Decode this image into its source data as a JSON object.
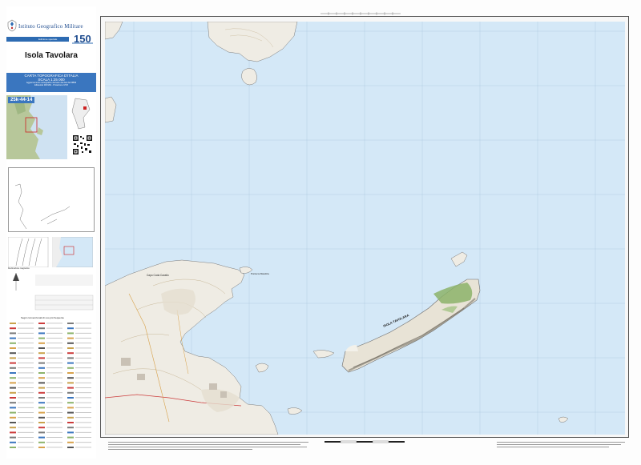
{
  "header": {
    "org_name": "Istituto Geografico Militare",
    "edition": "Edizione speciale",
    "badge": "150"
  },
  "sheet": {
    "title": "Isola Tavolara",
    "series_line1": "CARTA TOPOGRAFICA D'ITALIA",
    "series_line2": "SCALA 1:25 000",
    "series_line3": "Aggiornamento cartografico derivato dai dati del DBMI",
    "series_line4": "Ellissoide WGS84 - Proiezione UTM",
    "code": "25k-44-14"
  },
  "map": {
    "labels": {
      "isola_tavolara": "ISOLA TAVOLARA",
      "capo_coda_cavallo": "Capo Coda Cavallo",
      "punta_la_mandria": "Punta la Mandria"
    }
  },
  "legend": {
    "title": "Segni convenzionali di uso più frequente",
    "mag_note": "Declinazione magnetica"
  },
  "colors": {
    "sea": "#d4e8f7",
    "land": "#f3f1ea",
    "accent_blue": "#3a76bf",
    "relief_green": "#8cb36a"
  }
}
